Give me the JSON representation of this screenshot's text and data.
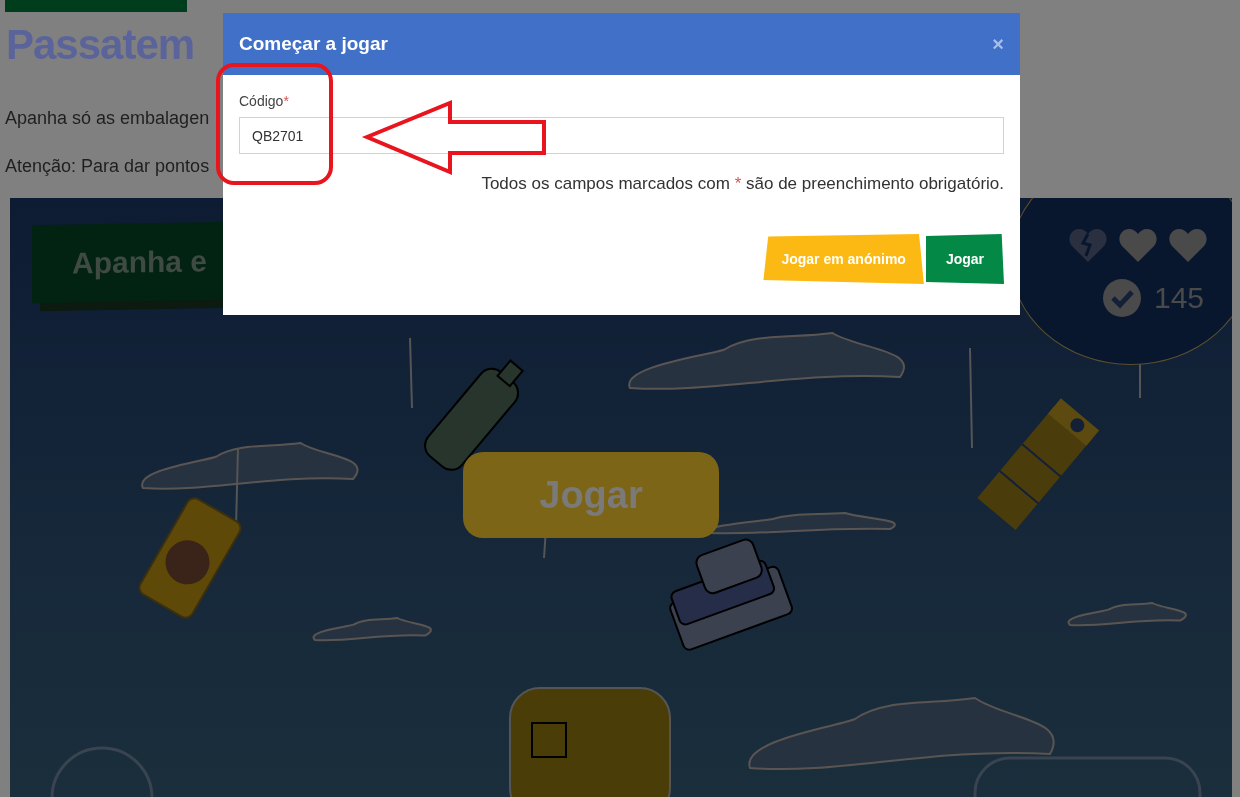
{
  "page": {
    "title": "Passatem",
    "paragraphs": [
      "Apanha só as embalagen",
      "Atenção: Para dar pontos"
    ]
  },
  "game": {
    "banner": "Apanha e",
    "play_button": "Jogar",
    "lives": [
      {
        "broken": true
      },
      {
        "broken": false
      },
      {
        "broken": false
      }
    ],
    "score": "145"
  },
  "dialog": {
    "title": "Começar a jogar",
    "close": "×",
    "fields": [
      {
        "label": "Código",
        "required_mark": "*",
        "value": "QB2701"
      }
    ],
    "note": {
      "before": "Todos os campos marcados com",
      "mark": "*",
      "after": "são de preenchimento obrigatório."
    },
    "buttons": [
      {
        "label": "Jogar em anónimo",
        "kind": "secondary"
      },
      {
        "label": "Jogar",
        "kind": "primary"
      }
    ]
  }
}
